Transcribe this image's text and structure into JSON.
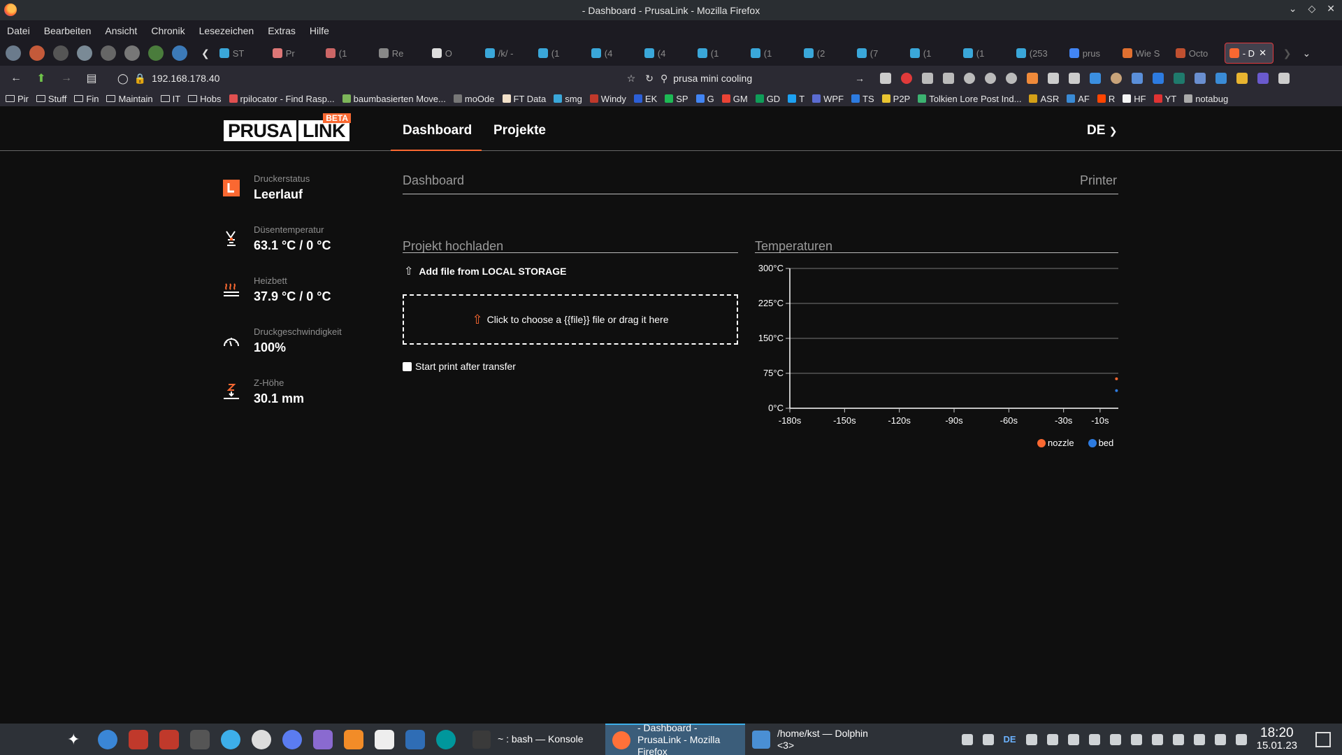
{
  "window": {
    "title": "- Dashboard - PrusaLink - Mozilla Firefox"
  },
  "menu": [
    "Datei",
    "Bearbeiten",
    "Ansicht",
    "Chronik",
    "Lesezeichen",
    "Extras",
    "Hilfe"
  ],
  "tabs": [
    {
      "label": "ST"
    },
    {
      "label": "Pr"
    },
    {
      "label": "(1"
    },
    {
      "label": "Re"
    },
    {
      "label": "O"
    },
    {
      "label": "/k/ - "
    },
    {
      "label": "(1"
    },
    {
      "label": "(4"
    },
    {
      "label": "(4"
    },
    {
      "label": "(1"
    },
    {
      "label": "(1"
    },
    {
      "label": "(2"
    },
    {
      "label": "(7"
    },
    {
      "label": "(1"
    },
    {
      "label": "(1"
    },
    {
      "label": "(253"
    },
    {
      "label": "prus"
    },
    {
      "label": "Wie S"
    },
    {
      "label": "Octo"
    },
    {
      "label": "- D",
      "active": true
    }
  ],
  "nav": {
    "url": "192.168.178.40",
    "search": "prusa mini cooling"
  },
  "bookmarks": [
    {
      "label": "Pir",
      "folder": true
    },
    {
      "label": "Stuff",
      "folder": true
    },
    {
      "label": "Fin",
      "folder": true
    },
    {
      "label": "Maintain",
      "folder": true
    },
    {
      "label": "IT",
      "folder": true
    },
    {
      "label": "Hobs",
      "folder": true
    },
    {
      "label": "rpilocator - Find Rasp...",
      "color": "#e05050"
    },
    {
      "label": "baumbasierten Move...",
      "color": "#7db65a"
    },
    {
      "label": "moOde",
      "color": "#777"
    },
    {
      "label": "FT Data",
      "color": "#f2e0c8"
    },
    {
      "label": "smg",
      "color": "#3aa7d9"
    },
    {
      "label": "Windy",
      "color": "#c0392b"
    },
    {
      "label": "EK",
      "color": "#2c5fd7"
    },
    {
      "label": "SP",
      "color": "#1db954"
    },
    {
      "label": "G",
      "color": "#4285f4"
    },
    {
      "label": "GM",
      "color": "#ea4335"
    },
    {
      "label": "GD",
      "color": "#0f9d58"
    },
    {
      "label": "T",
      "color": "#1da1f2"
    },
    {
      "label": "WPF",
      "color": "#5b6cd1"
    },
    {
      "label": "TS",
      "color": "#2d7be0"
    },
    {
      "label": "P2P",
      "color": "#e8c431"
    },
    {
      "label": "Tolkien Lore Post Ind...",
      "color": "#3cb371"
    },
    {
      "label": "ASR",
      "color": "#d4a017"
    },
    {
      "label": "AF",
      "color": "#3a8bd6"
    },
    {
      "label": "R",
      "color": "#ff4500"
    },
    {
      "label": "HF",
      "color": "#f5f5f5"
    },
    {
      "label": "YT",
      "color": "#e03333"
    },
    {
      "label": "notabug",
      "color": "#aaa"
    }
  ],
  "app": {
    "logo_left": "PRUSA",
    "logo_right": "LINK",
    "logo_badge": "BETA",
    "nav_dashboard": "Dashboard",
    "nav_projects": "Projekte",
    "language": "DE",
    "breadcrumb_left": "Dashboard",
    "breadcrumb_right": "Printer",
    "upload_title": "Projekt hochladen",
    "upload_source": "Add file from LOCAL STORAGE",
    "dropzone_text": "Click to choose a {{file}} file or drag it here",
    "start_print": "Start print after transfer",
    "temps_title": "Temperaturen"
  },
  "status": [
    {
      "label": "Druckerstatus",
      "value": "Leerlauf",
      "icon": "printer-status-icon"
    },
    {
      "label": "Düsentemperatur",
      "value": "63.1 °C / 0 °C",
      "icon": "nozzle-icon"
    },
    {
      "label": "Heizbett",
      "value": "37.9 °C / 0 °C",
      "icon": "heatbed-icon"
    },
    {
      "label": "Druckgeschwindigkeit",
      "value": "100%",
      "icon": "speedometer-icon"
    },
    {
      "label": "Z-Höhe",
      "value": "30.1 mm",
      "icon": "z-height-icon"
    }
  ],
  "chart_data": {
    "type": "line",
    "title": "",
    "x_ticks": [
      "-180s",
      "-150s",
      "-120s",
      "-90s",
      "-60s",
      "-30s",
      "-10s"
    ],
    "x_tick_values": [
      -180,
      -150,
      -120,
      -90,
      -60,
      -30,
      -10
    ],
    "xlim": [
      -180,
      0
    ],
    "y_ticks": [
      "300°C",
      "225°C",
      "150°C",
      "75°C",
      "0°C"
    ],
    "y_tick_values": [
      300,
      225,
      150,
      75,
      0
    ],
    "ylim": [
      0,
      300
    ],
    "grid": true,
    "legend_position": "bottom-right",
    "series": [
      {
        "name": "nozzle",
        "color": "#fa6831",
        "points": [
          [
            -1,
            63.1
          ]
        ]
      },
      {
        "name": "bed",
        "color": "#2d7be0",
        "points": [
          [
            -1,
            37.9
          ]
        ]
      }
    ]
  },
  "taskbar": {
    "tasks": [
      {
        "label": "~ : bash — Konsole"
      },
      {
        "label": "- Dashboard - PrusaLink - Mozilla Firefox",
        "active": true
      },
      {
        "label": "/home/kst — Dolphin <3>"
      }
    ],
    "keyboard_layout": "DE",
    "time": "18:20",
    "date": "15.01.23"
  }
}
